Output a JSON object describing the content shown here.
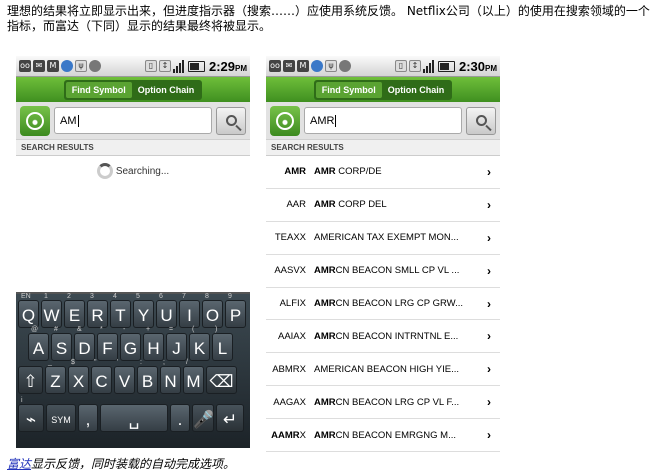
{
  "intro_text": "理想的结果将立即显示出来，但进度指示器（搜索……）应使用系统反馈。 Netflix公司（以上）的使用在搜索领域的一个指标，而富达（下同）显示的结果最终将被显示。",
  "caption": {
    "link": "富达",
    "text": "显示反馈，同时装载的自动完成选项。"
  },
  "left_phone": {
    "time": "2:29",
    "time_suffix": "PM",
    "tabs": [
      "Find Symbol",
      "Option Chain"
    ],
    "search_value": "AM",
    "results_header": "SEARCH RESULTS",
    "status_text": "Searching..."
  },
  "right_phone": {
    "time": "2:30",
    "time_suffix": "PM",
    "tabs": [
      "Find Symbol",
      "Option Chain"
    ],
    "search_value": "AMR",
    "results_header": "SEARCH RESULTS",
    "results": [
      {
        "symbol_bold": "AMR",
        "symbol_rest": "",
        "name_bold": "AMR",
        "name_rest": " CORP/DE"
      },
      {
        "symbol_bold": "",
        "symbol_rest": "AAR",
        "name_bold": "AMR",
        "name_rest": " CORP DEL"
      },
      {
        "symbol_bold": "",
        "symbol_rest": "TEAXX",
        "name_bold": "",
        "name_rest": "AMERICAN TAX EXEMPT MON..."
      },
      {
        "symbol_bold": "",
        "symbol_rest": "AASVX",
        "name_bold": "AMR",
        "name_rest": "CN BEACON SMLL CP VL ..."
      },
      {
        "symbol_bold": "",
        "symbol_rest": "ALFIX",
        "name_bold": "AMR",
        "name_rest": "CN BEACON LRG CP GRW..."
      },
      {
        "symbol_bold": "",
        "symbol_rest": "AAIAX",
        "name_bold": "AMR",
        "name_rest": "CN BEACON INTRNTNL E..."
      },
      {
        "symbol_bold": "",
        "symbol_rest": "ABMRX",
        "name_bold": "",
        "name_rest": "AMERICAN BEACON HIGH YIE..."
      },
      {
        "symbol_bold": "",
        "symbol_rest": "AAGAX",
        "name_bold": "AMR",
        "name_rest": "CN BEACON LRG CP VL F..."
      },
      {
        "symbol_bold": "AAMR",
        "symbol_rest": "X",
        "name_bold": "AMR",
        "name_rest": "CN BEACON EMRGNG M..."
      }
    ]
  },
  "keyboard": {
    "row1": [
      {
        "k": "Q",
        "s": "EN"
      },
      {
        "k": "W",
        "s": "1"
      },
      {
        "k": "E",
        "s": "2"
      },
      {
        "k": "R",
        "s": "3"
      },
      {
        "k": "T",
        "s": "4"
      },
      {
        "k": "Y",
        "s": "5"
      },
      {
        "k": "U",
        "s": "6"
      },
      {
        "k": "I",
        "s": "7"
      },
      {
        "k": "O",
        "s": "8"
      },
      {
        "k": "P",
        "s": "9"
      }
    ],
    "row2": [
      {
        "k": "A",
        "s": "@"
      },
      {
        "k": "S",
        "s": "#"
      },
      {
        "k": "D",
        "s": "&"
      },
      {
        "k": "F",
        "s": "*"
      },
      {
        "k": "G",
        "s": "-"
      },
      {
        "k": "H",
        "s": "+"
      },
      {
        "k": "J",
        "s": "="
      },
      {
        "k": "K",
        "s": "("
      },
      {
        "k": "L",
        "s": ")"
      }
    ],
    "row3": [
      {
        "k": "Z",
        "s": "_"
      },
      {
        "k": "X",
        "s": "$"
      },
      {
        "k": "C",
        "s": "\""
      },
      {
        "k": "V",
        "s": "'"
      },
      {
        "k": "B",
        "s": ":"
      },
      {
        "k": "N",
        "s": ";"
      },
      {
        "k": "M",
        "s": "/"
      }
    ],
    "sym_label": "SYM",
    "comma": ",",
    "period": "."
  }
}
